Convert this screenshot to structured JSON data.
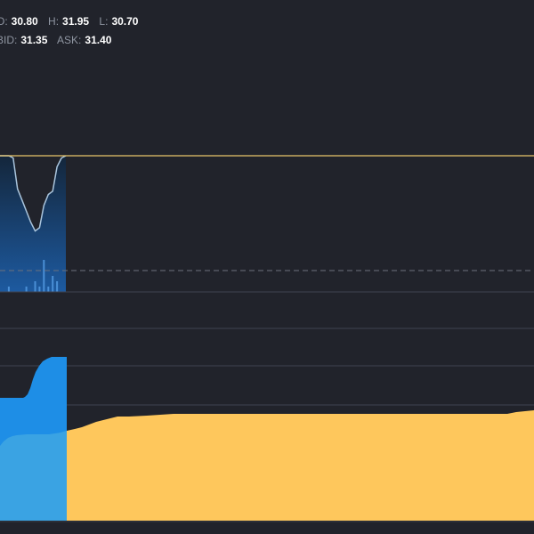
{
  "quote": {
    "open_label": "O:",
    "open_value": "30.80",
    "high_label": "H:",
    "high_value": "31.95",
    "low_label": "L:",
    "low_value": "30.70",
    "bid_label": "BID:",
    "bid_value": "31.35",
    "ask_label": "ASK:",
    "ask_value": "31.40"
  },
  "colors": {
    "background": "#21232b",
    "price_line": "#e8c46a",
    "price_area_top": "#1b3350",
    "price_area_bottom": "#1d5aa0",
    "intraday_line": "#a9c4dc",
    "volume_bar": "#4a8fd6",
    "depth_blue_dark": "#1e8ee6",
    "depth_blue_light": "#3aa3e3",
    "depth_yellow": "#fec75c",
    "separator": "#3f4350"
  },
  "chart_data": {
    "type": "area",
    "series": [
      {
        "values": [
          31.4,
          31.4,
          31.4,
          31.38,
          31.1,
          31.0,
          30.9,
          30.8,
          30.72,
          30.75,
          30.95,
          31.05,
          31.08,
          31.3,
          31.38,
          31.4
        ]
      }
    ],
    "volume": [
      0,
      0,
      1,
      0,
      0,
      0,
      1,
      0,
      2,
      1,
      6,
      1,
      3,
      2,
      0,
      0
    ],
    "reference_level": 31.4,
    "dashed_level": 30.7
  }
}
